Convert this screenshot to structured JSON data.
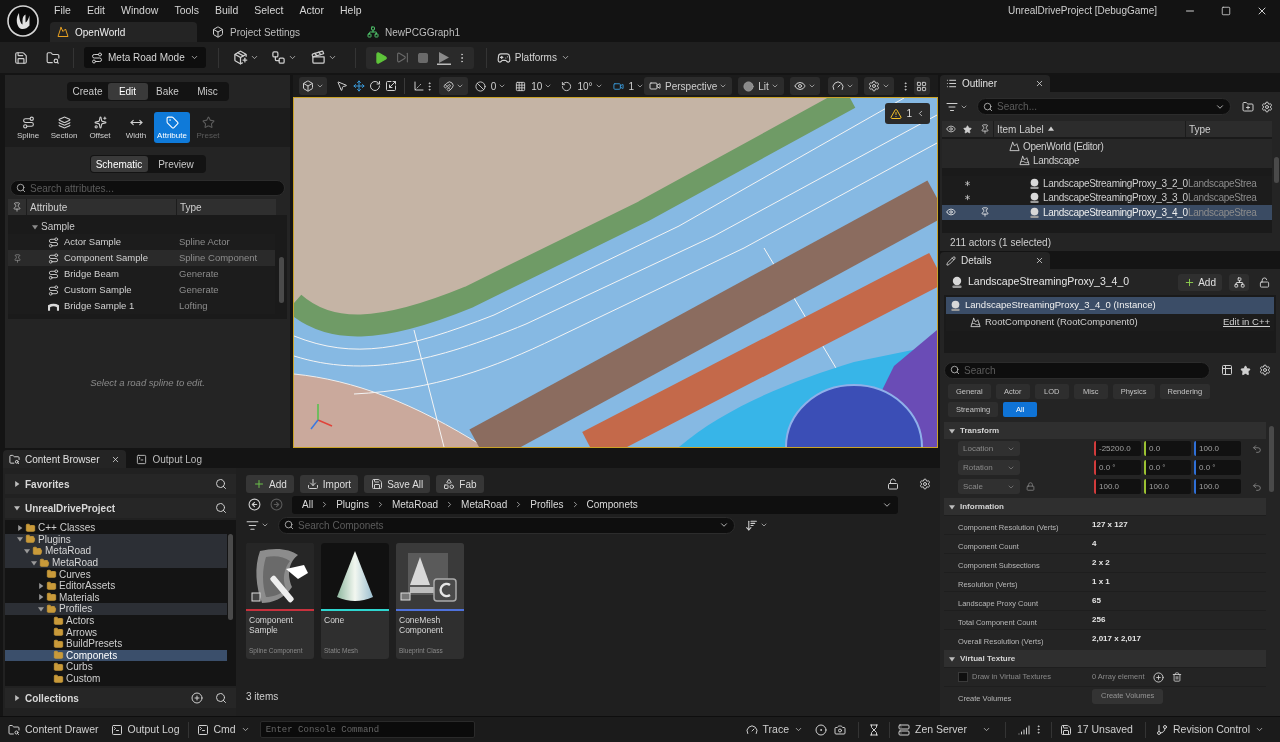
{
  "menu": [
    "File",
    "Edit",
    "Window",
    "Tools",
    "Build",
    "Select",
    "Actor",
    "Help"
  ],
  "window_title": "UnrealDriveProject [DebugGame]",
  "doc_tabs": [
    {
      "label": "OpenWorld",
      "selected": true
    },
    {
      "label": "Project Settings",
      "selected": false
    },
    {
      "label": "NewPCGGraph1",
      "selected": false
    }
  ],
  "toolbar": {
    "mode": "Meta Road Mode",
    "platforms": "Platforms"
  },
  "mode_panel": {
    "tabs": [
      {
        "label": "Create",
        "selected": false
      },
      {
        "label": "Edit",
        "selected": true
      },
      {
        "label": "Bake",
        "selected": false
      },
      {
        "label": "Misc",
        "selected": false
      }
    ],
    "tools": [
      {
        "label": "Spline",
        "selected": false,
        "disabled": false
      },
      {
        "label": "Section",
        "selected": false,
        "disabled": false
      },
      {
        "label": "Offset",
        "selected": false,
        "disabled": false
      },
      {
        "label": "Width",
        "selected": false,
        "disabled": false
      },
      {
        "label": "Attribute",
        "selected": true,
        "disabled": false
      },
      {
        "label": "Preset",
        "selected": false,
        "disabled": true
      }
    ],
    "views": [
      {
        "label": "Schematic",
        "selected": true
      },
      {
        "label": "Preview",
        "selected": false
      }
    ],
    "search": {
      "placeholder": "Search attributes..."
    },
    "columns": [
      "Attribute",
      "Type"
    ],
    "attributes": [
      {
        "label": "Sample",
        "expanded": true,
        "children": [
          {
            "label": "Actor Sample",
            "type": "Spline Actor",
            "kind": "spline",
            "highlighted": false
          },
          {
            "label": "Component Sample",
            "type": "Spline Component",
            "kind": "spline",
            "highlighted": true
          },
          {
            "label": "Bridge Beam",
            "type": "Generate",
            "kind": "spline",
            "highlighted": false
          },
          {
            "label": "Custom Sample",
            "type": "Generate",
            "kind": "spline",
            "highlighted": false
          },
          {
            "label": "Bridge Sample 1",
            "type": "Lofting",
            "kind": "lofting",
            "highlighted": false
          }
        ]
      }
    ],
    "hint": "Select a road spline to edit."
  },
  "viewport": {
    "surface_snap": "0",
    "grid_snap": "10",
    "rotation_snap": "10°",
    "camera_speed": "1",
    "view": "Perspective",
    "shading": "Lit",
    "warnings": "1"
  },
  "outliner": {
    "title": "Outliner",
    "search": {
      "placeholder": "Search..."
    },
    "columns": [
      "Item Label",
      "Type"
    ],
    "tree": [
      {
        "label": "OpenWorld (Editor)",
        "selected": false,
        "unsaved": false,
        "children": [
          {
            "label": "Landscape",
            "selected": false,
            "unsaved": false,
            "children": [
              {
                "label": "LandscapeStreamingProxy_3_2_0",
                "type": "LandscapeStrea",
                "selected": false,
                "unsaved": true
              },
              {
                "label": "LandscapeStreamingProxy_3_3_0",
                "type": "LandscapeStrea",
                "selected": false,
                "unsaved": true
              },
              {
                "label": "LandscapeStreamingProxy_3_4_0",
                "type": "LandscapeStrea",
                "selected": true,
                "unsaved": false
              }
            ]
          }
        ]
      }
    ],
    "status": "211 actors (1 selected)"
  },
  "details": {
    "title": "Details",
    "actor": "LandscapeStreamingProxy_3_4_0",
    "add": "Add",
    "components": [
      {
        "label": "LandscapeStreamingProxy_3_4_0 (Instance)",
        "selected": true,
        "children": [
          {
            "label": "RootComponent (RootComponent0)",
            "selected": false,
            "link": "Edit in C++"
          }
        ]
      }
    ],
    "search": {
      "placeholder": "Search"
    },
    "filters": [
      {
        "label": "General",
        "selected": false
      },
      {
        "label": "Actor",
        "selected": false
      },
      {
        "label": "LOD",
        "selected": false
      },
      {
        "label": "Misc",
        "selected": false
      },
      {
        "label": "Physics",
        "selected": false
      },
      {
        "label": "Rendering",
        "selected": false
      },
      {
        "label": "Streaming",
        "selected": false
      },
      {
        "label": "All",
        "selected": true
      }
    ],
    "sections": [
      {
        "kind": "transform",
        "title": "Transform",
        "expanded": true,
        "rows": [
          {
            "label": "Location",
            "values": [
              "-25200.0",
              "0.0",
              "100.0"
            ],
            "reset": true
          },
          {
            "label": "Rotation",
            "values": [
              "0.0 °",
              "0.0 °",
              "0.0 °"
            ],
            "reset": false
          },
          {
            "label": "Scale",
            "values": [
              "100.0",
              "100.0",
              "100.0"
            ],
            "reset": true,
            "locked": true
          }
        ]
      },
      {
        "kind": "properties",
        "title": "Information",
        "expanded": true,
        "rows": [
          {
            "label": "Component Resolution (Verts)",
            "value": "127 x 127"
          },
          {
            "label": "Component Count",
            "value": "4"
          },
          {
            "label": "Component Subsections",
            "value": "2 x 2"
          },
          {
            "label": "Resolution (Verts)",
            "value": "1 x 1"
          },
          {
            "label": "Landscape Proxy Count",
            "value": "65"
          },
          {
            "label": "Total Component Count",
            "value": "256"
          },
          {
            "label": "Overall Resolution (Verts)",
            "value": "2,017 x 2,017"
          }
        ]
      },
      {
        "kind": "virtual_texture",
        "title": "Virtual Texture",
        "expanded": true,
        "rows": [
          {
            "kind": "array",
            "label": "Draw in Virtual Textures",
            "value": "0 Array element",
            "checked": false,
            "disabled": true
          },
          {
            "kind": "button",
            "label": "Create Volumes",
            "button": "Create Volumes",
            "disabled": true
          }
        ]
      }
    ]
  },
  "content_browser": {
    "tabs": [
      {
        "label": "Content Browser",
        "selected": true
      },
      {
        "label": "Output Log",
        "selected": false
      }
    ],
    "favorites": {
      "label": "Favorites",
      "expanded": false
    },
    "project": {
      "label": "UnrealDriveProject",
      "expanded": true
    },
    "collections": {
      "label": "Collections",
      "expanded": false
    },
    "folders": [
      {
        "label": "C++ Classes",
        "expanded": false,
        "selected": false,
        "in_path": false
      },
      {
        "label": "Plugins",
        "expanded": true,
        "selected": false,
        "in_path": true,
        "children": [
          {
            "label": "MetaRoad",
            "expanded": true,
            "selected": false,
            "in_path": true,
            "children": [
              {
                "label": "MetaRoad",
                "expanded": true,
                "selected": false,
                "in_path": true,
                "children": [
                  {
                    "label": "Curves",
                    "selected": false,
                    "in_path": false
                  },
                  {
                    "label": "EditorAssets",
                    "expanded": false,
                    "selected": false,
                    "in_path": false
                  },
                  {
                    "label": "Materials",
                    "expanded": false,
                    "selected": false,
                    "in_path": false
                  },
                  {
                    "label": "Profiles",
                    "expanded": true,
                    "selected": false,
                    "in_path": true,
                    "children": [
                      {
                        "label": "Actors",
                        "selected": false,
                        "in_path": false
                      },
                      {
                        "label": "Arrows",
                        "selected": false,
                        "in_path": false
                      },
                      {
                        "label": "BuildPresets",
                        "selected": false,
                        "in_path": false
                      },
                      {
                        "label": "Componets",
                        "selected": true,
                        "in_path": false
                      },
                      {
                        "label": "Curbs",
                        "selected": false,
                        "in_path": false
                      },
                      {
                        "label": "Custom",
                        "selected": false,
                        "in_path": false
                      }
                    ]
                  }
                ]
              }
            ]
          }
        ]
      }
    ],
    "actions": [
      "Add",
      "Import",
      "Save All",
      "Fab"
    ],
    "path": [
      "All",
      "Plugins",
      "MetaRoad",
      "MetaRoad",
      "Profiles",
      "Componets"
    ],
    "search": {
      "placeholder": "Search Componets"
    },
    "assets": [
      {
        "name": "Component Sample",
        "type": "Spline Component",
        "kind": "spline",
        "color": "#c8313d"
      },
      {
        "name": "Cone",
        "type": "Static Mesh",
        "kind": "mesh",
        "color": "#2fd6d0"
      },
      {
        "name": "ConeMesh Component",
        "type": "Blueprint Class",
        "kind": "blueprint",
        "color": "#4f72dc"
      }
    ],
    "count": "3 items"
  },
  "status_bar": {
    "content_drawer": "Content Drawer",
    "output_log": "Output Log",
    "cmd": "Cmd",
    "console": {
      "placeholder": "Enter Console Command"
    },
    "trace": "Trace",
    "zen_server": "Zen Server",
    "unsaved": "17 Unsaved",
    "revision_control": "Revision Control"
  }
}
